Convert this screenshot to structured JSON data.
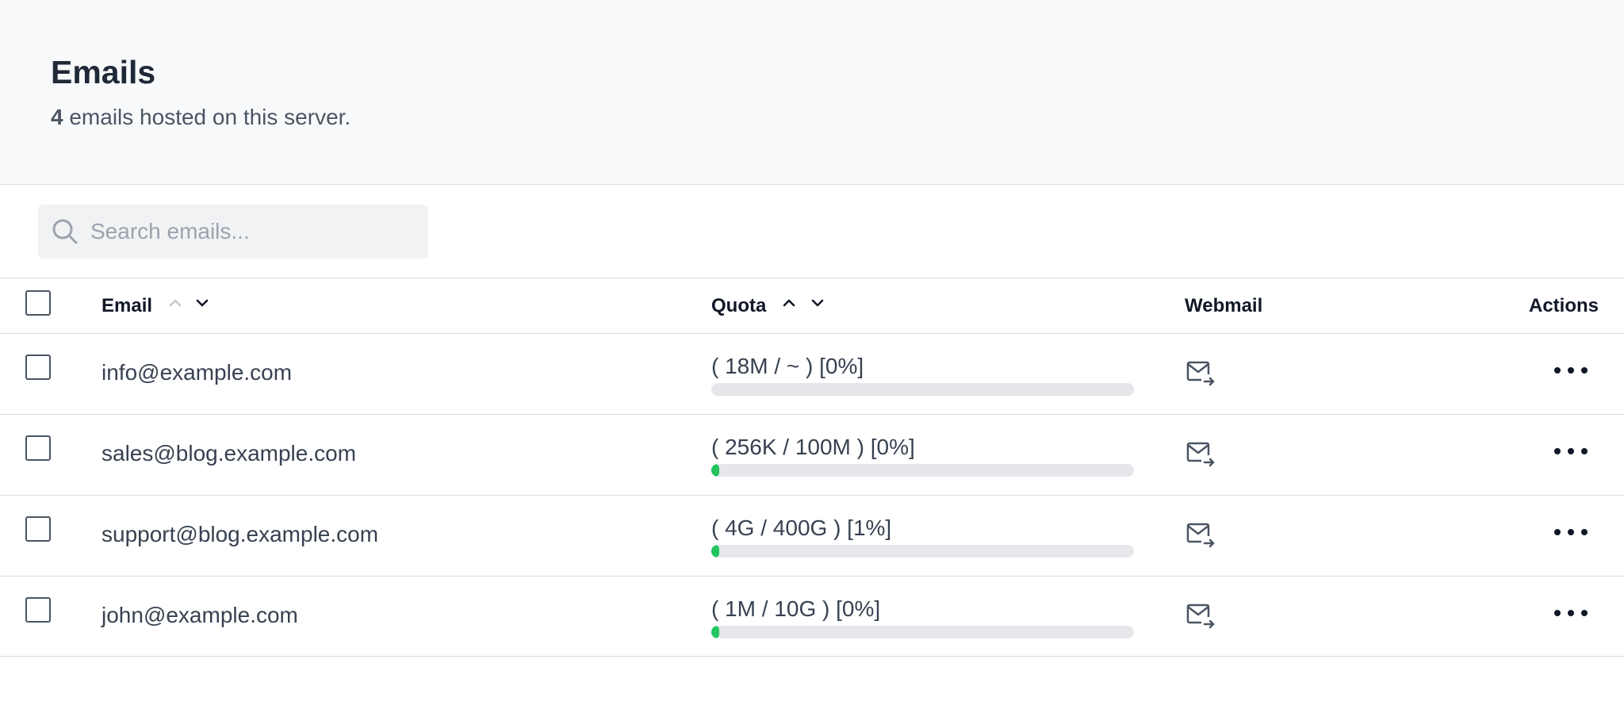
{
  "header": {
    "title": "Emails",
    "count": "4",
    "subtitle_rest": " emails hosted on this server."
  },
  "search": {
    "placeholder": "Search emails..."
  },
  "table": {
    "columns": {
      "email": "Email",
      "quota": "Quota",
      "webmail": "Webmail",
      "actions": "Actions"
    },
    "rows": [
      {
        "email": "info@example.com",
        "quota": "( 18M / ~ ) [0%]",
        "usage_fraction": 0
      },
      {
        "email": "sales@blog.example.com",
        "quota": "( 256K / 100M ) [0%]",
        "usage_fraction": 0.003
      },
      {
        "email": "support@blog.example.com",
        "quota": "( 4G / 400G ) [1%]",
        "usage_fraction": 0.01
      },
      {
        "email": "john@example.com",
        "quota": "( 1M / 10G ) [0%]",
        "usage_fraction": 0.0001
      }
    ]
  },
  "colors": {
    "quota_fill": "#22c55e",
    "quota_track": "#e5e7eb",
    "header_bg": "#f8f9fb"
  },
  "icons": {
    "search": "search-icon",
    "webmail": "mail-forward-icon",
    "actions": "more-horizontal-icon"
  }
}
